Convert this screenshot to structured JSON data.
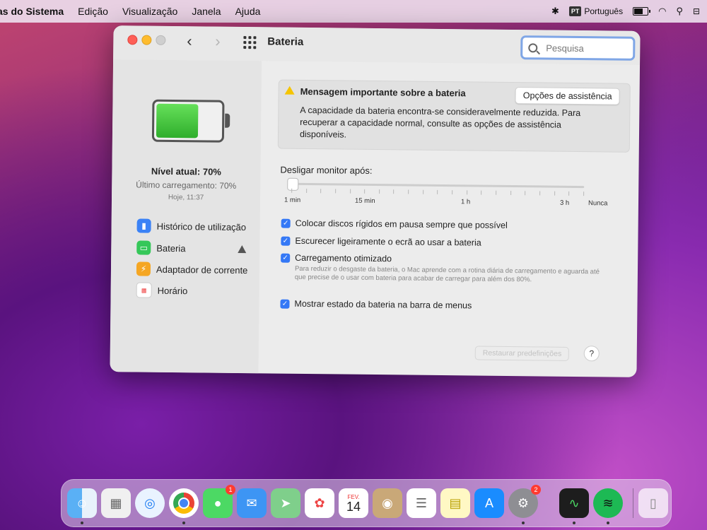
{
  "menubar": {
    "items": [
      "as do Sistema",
      "Edição",
      "Visualização",
      "Janela",
      "Ajuda"
    ],
    "input_source": {
      "badge": "PT",
      "label": "Português"
    }
  },
  "window": {
    "title": "Bateria",
    "search_placeholder": "Pesquisa"
  },
  "sidebar": {
    "level": "Nível atual: 70%",
    "last_charge": "Último carregamento: 70%",
    "time": "Hoje, 11:37",
    "items": [
      {
        "label": "Histórico de utilização",
        "icon": "chart-icon"
      },
      {
        "label": "Bateria",
        "icon": "battery-icon",
        "warning": true
      },
      {
        "label": "Adaptador de corrente",
        "icon": "power-adapter-icon"
      },
      {
        "label": "Horário",
        "icon": "calendar-icon"
      }
    ],
    "battery_level": 0.7
  },
  "alert": {
    "title": "Mensagem importante sobre a bateria",
    "body": "A capacidade da bateria encontra-se consideravelmente reduzida. Para recuperar a capacidade normal, consulte as opções de assistência disponíveis.",
    "button": "Opções de assistência"
  },
  "display_off": {
    "label": "Desligar monitor após:",
    "tick_labels": [
      "1 min",
      "15 min",
      "1 h",
      "3 h",
      "Nunca"
    ],
    "value": "1 min"
  },
  "options": [
    {
      "label": "Colocar discos rígidos em pausa sempre que possível",
      "checked": true
    },
    {
      "label": "Escurecer ligeiramente o ecrã ao usar a bateria",
      "checked": true
    },
    {
      "label": "Carregamento otimizado",
      "checked": true
    },
    {
      "label": "Mostrar estado da bateria na barra de menus",
      "checked": true
    }
  ],
  "optimized_note": "Para reduzir o desgaste da bateria, o Mac aprende com a rotina diária de carregamento e aguarda até que precise de o usar com bateria para acabar de carregar para além dos 80%.",
  "footer": {
    "restore": "Restaurar predefinições",
    "help": "?"
  },
  "dock": {
    "calendar_month": "FEV.",
    "calendar_day": "14",
    "messages_badge": "1",
    "settings_badge": "2"
  }
}
